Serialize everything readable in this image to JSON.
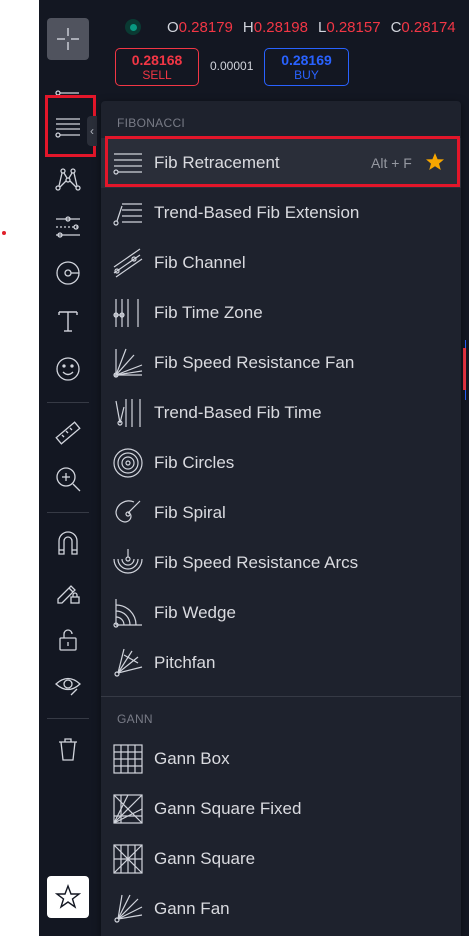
{
  "ohlc": {
    "open_label": "O",
    "open": "0.28179",
    "high_label": "H",
    "high": "0.28198",
    "low_label": "L",
    "low": "0.28157",
    "close_label": "C",
    "close": "0.28174"
  },
  "trade": {
    "sell_price": "0.28168",
    "sell_label": "SELL",
    "spread": "0.00001",
    "buy_price": "0.28169",
    "buy_label": "BUY"
  },
  "toolbar": {
    "tools": [
      "crosshair-icon",
      "trend-line-icon",
      "fib-retracement-icon",
      "pattern-icon",
      "prediction-icon",
      "brush-icon",
      "text-icon",
      "emoji-icon",
      "ruler-icon",
      "zoom-in-icon",
      "magnet-icon",
      "lock-drawing-icon",
      "lock-icon",
      "eye-icon",
      "trash-icon",
      "star-icon"
    ]
  },
  "menu": {
    "fib_section": "FIBONACCI",
    "gann_section": "GANN",
    "fib_items": [
      {
        "label": "Fib Retracement",
        "shortcut": "Alt + F",
        "icon": "fib-retracement-icon"
      },
      {
        "label": "Trend-Based Fib Extension",
        "icon": "trend-fib-extension-icon"
      },
      {
        "label": "Fib Channel",
        "icon": "fib-channel-icon"
      },
      {
        "label": "Fib Time Zone",
        "icon": "fib-time-zone-icon"
      },
      {
        "label": "Fib Speed Resistance Fan",
        "icon": "fib-speed-fan-icon"
      },
      {
        "label": "Trend-Based Fib Time",
        "icon": "trend-fib-time-icon"
      },
      {
        "label": "Fib Circles",
        "icon": "fib-circles-icon"
      },
      {
        "label": "Fib Spiral",
        "icon": "fib-spiral-icon"
      },
      {
        "label": "Fib Speed Resistance Arcs",
        "icon": "fib-arcs-icon"
      },
      {
        "label": "Fib Wedge",
        "icon": "fib-wedge-icon"
      },
      {
        "label": "Pitchfan",
        "icon": "pitchfan-icon"
      }
    ],
    "gann_items": [
      {
        "label": "Gann Box",
        "icon": "gann-box-icon"
      },
      {
        "label": "Gann Square Fixed",
        "icon": "gann-square-fixed-icon"
      },
      {
        "label": "Gann Square",
        "icon": "gann-square-icon"
      },
      {
        "label": "Gann Fan",
        "icon": "gann-fan-icon"
      }
    ]
  },
  "colors": {
    "toolbar_bg": "#131722",
    "menu_bg": "#1e222d",
    "sell": "#f23645",
    "buy": "#2962ff",
    "highlight": "#e3162a",
    "favorite_star": "#f7a600"
  }
}
